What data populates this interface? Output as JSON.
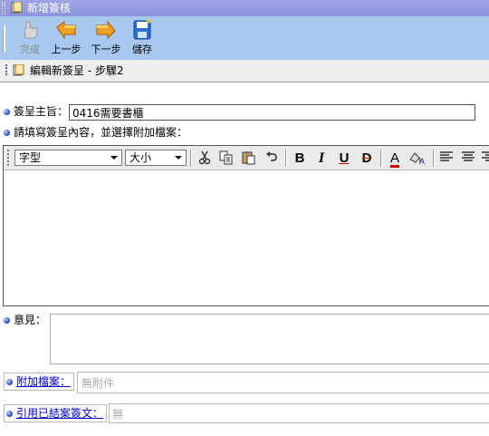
{
  "window": {
    "title": "新增簽核"
  },
  "toolbar": {
    "buttons": [
      {
        "label": "完成",
        "icon": "hand-icon",
        "enabled": false
      },
      {
        "label": "上一步",
        "icon": "back-arrow-icon",
        "enabled": true
      },
      {
        "label": "下一步",
        "icon": "forward-arrow-icon",
        "enabled": true
      },
      {
        "label": "儲存",
        "icon": "save-disk-icon",
        "enabled": true
      }
    ]
  },
  "step": {
    "title": "編輯新簽呈 - 步驟2"
  },
  "form": {
    "subject_label": "簽呈主旨：",
    "subject_value": "0416需要書櫃",
    "content_label": "請填寫簽呈內容，並選擇附加檔案：",
    "font_select": "字型",
    "size_select": "大小",
    "opinion_label": "意見：",
    "attach_label": "附加檔案：",
    "attach_placeholder": "無附件",
    "cite_label": "引用已結案簽文：",
    "cite_placeholder": "無"
  },
  "editor_tools": [
    "cut-icon",
    "copy-icon",
    "paste-icon",
    "undo-icon",
    "bold-icon",
    "italic-icon",
    "underline-icon",
    "strikethrough-icon",
    "font-color-icon",
    "highlight-icon",
    "align-left-icon",
    "align-center-icon",
    "align-right-icon"
  ],
  "colors": {
    "titlebar": "#9ea4e4",
    "toolbar": "#a8c8ef",
    "link": "#0000cc"
  }
}
